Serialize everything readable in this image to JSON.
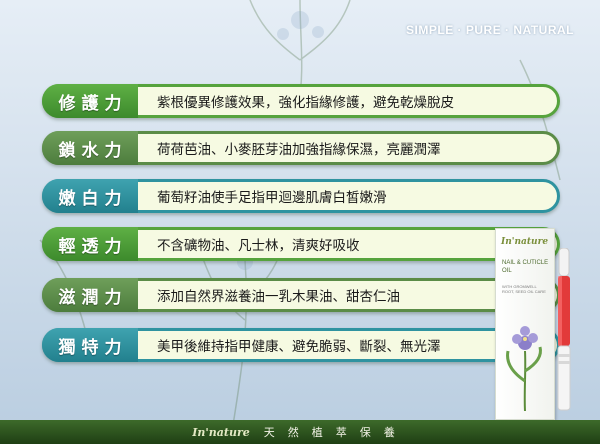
{
  "tagline": "SIMPLE · PURE · NATURAL",
  "features": [
    {
      "title": "修護力",
      "desc": "紫根優異修護效果，強化指緣修護，避免乾燥脫皮",
      "theme": "green"
    },
    {
      "title": "鎖水力",
      "desc": "荷荷芭油、小麥胚芽油加強指緣保濕，亮麗潤澤",
      "theme": "olive"
    },
    {
      "title": "嫩白力",
      "desc": "葡萄籽油使手足指甲迴邊肌膚白皙嫩滑",
      "theme": "teal"
    },
    {
      "title": "輕透力",
      "desc": "不含礦物油、凡士林，清爽好吸收",
      "theme": "green"
    },
    {
      "title": "滋潤力",
      "desc": "添加自然界滋養油一乳木果油、甜杏仁油",
      "theme": "olive"
    },
    {
      "title": "獨特力",
      "desc": "美甲後維持指甲健康、避免脆弱、斷裂、無光澤",
      "theme": "teal"
    }
  ],
  "product": {
    "brand": "In'nature",
    "title": "NAIL & CUTICLE OIL",
    "subtitle": "WITH GROMWELL ROOT, SEED OIL CARE"
  },
  "footer": {
    "brand": "In'nature",
    "motto": "天然植萃保養"
  },
  "colors": {
    "green": "#4f9a3a",
    "olive": "#5b8c47",
    "teal": "#2f93a0",
    "pill_bg": "#f6fae2",
    "footer": "#2e5420",
    "pen_tip": "#e23a3a"
  }
}
